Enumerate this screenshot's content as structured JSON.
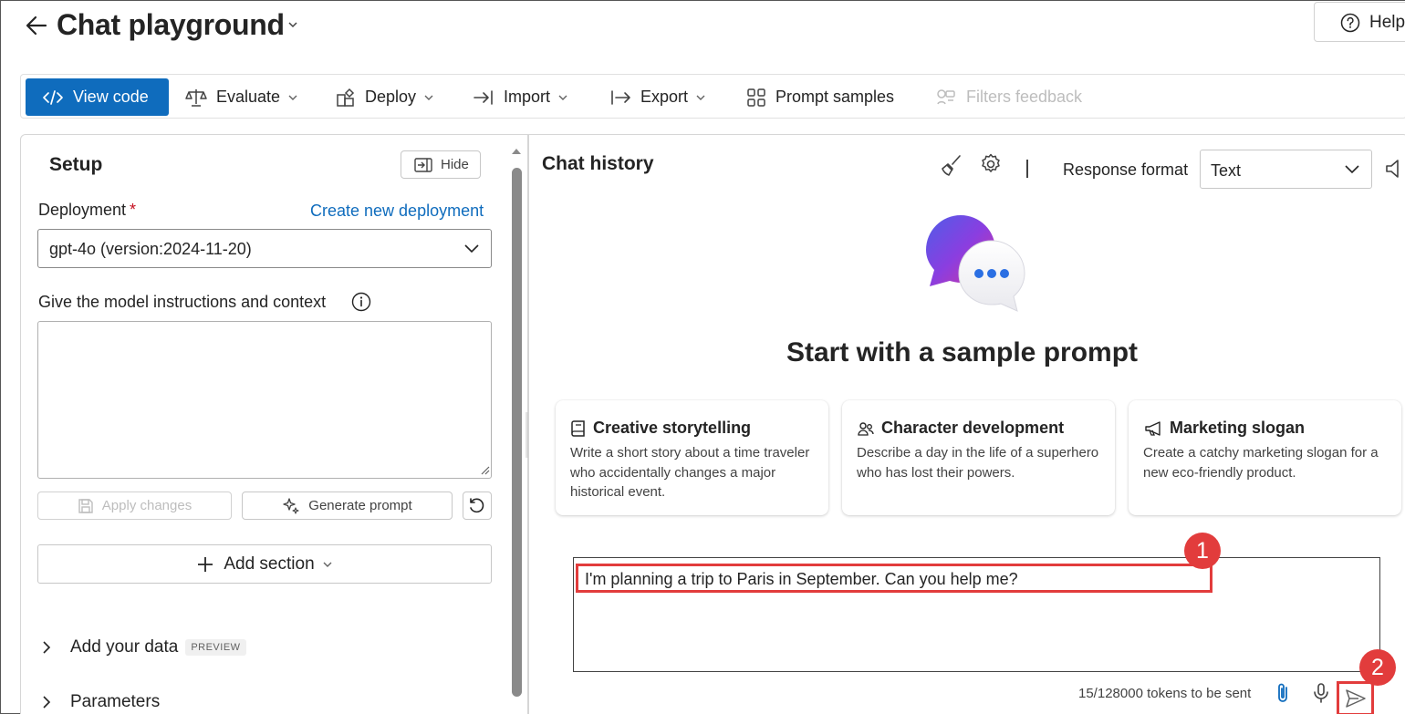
{
  "header": {
    "title": "Chat playground",
    "help_label": "Help"
  },
  "toolbar": {
    "view_code": "View code",
    "evaluate": "Evaluate",
    "deploy": "Deploy",
    "import": "Import",
    "export": "Export",
    "prompt_samples": "Prompt samples",
    "filters_feedback": "Filters feedback"
  },
  "setup": {
    "title": "Setup",
    "hide_label": "Hide",
    "deployment_label": "Deployment",
    "required_marker": "*",
    "create_link": "Create new deployment",
    "deployment_value": "gpt-4o (version:2024-11-20)",
    "instructions_label": "Give the model instructions and context",
    "instructions_value": "",
    "apply_changes": "Apply changes",
    "generate_prompt": "Generate prompt",
    "add_section": "Add section",
    "add_your_data": "Add your data",
    "preview_badge": "PREVIEW",
    "parameters": "Parameters"
  },
  "chat": {
    "title": "Chat history",
    "response_format_label": "Response format",
    "response_format_value": "Text",
    "hero_title": "Start with a sample prompt",
    "cards": [
      {
        "title": "Creative storytelling",
        "body": "Write a short story about a time traveler who accidentally changes a major historical event.",
        "icon": "book-icon"
      },
      {
        "title": "Character development",
        "body": "Describe a day in the life of a superhero who has lost their powers.",
        "icon": "people-icon"
      },
      {
        "title": "Marketing slogan",
        "body": "Create a catchy marketing slogan for a new eco-friendly product.",
        "icon": "megaphone-icon"
      }
    ],
    "input_value": "I'm planning a trip to Paris in September. Can you help me?",
    "tokens_text": "15/128000 tokens to be sent"
  },
  "annotations": {
    "marker1": "1",
    "marker2": "2",
    "color": "#e23c3c"
  },
  "colors": {
    "accent": "#0f6cbd",
    "required": "#c50f1f"
  }
}
